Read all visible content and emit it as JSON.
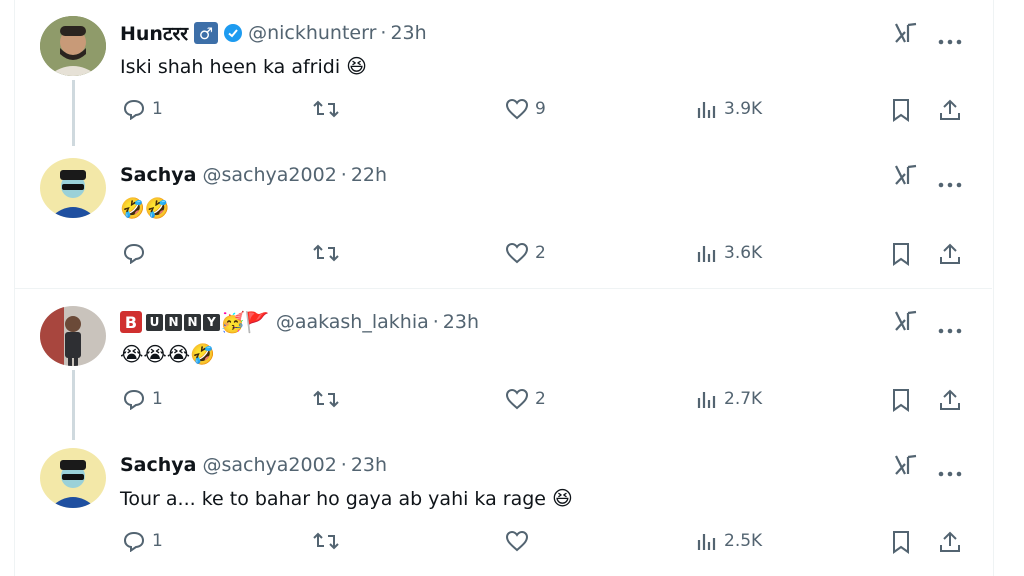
{
  "tweets": [
    {
      "name": "Hunटरर",
      "name_emoji": "♂",
      "verified": true,
      "handle": "@nickhunterr",
      "time": "23h",
      "text": "Iski shah heen ka afridi",
      "text_emoji": "😆",
      "replies": "1",
      "likes": "9",
      "views": "3.9K"
    },
    {
      "name": "Sachya",
      "handle": "@sachya2002",
      "time": "22h",
      "text_emoji": "🤣🤣",
      "replies": "",
      "likes": "2",
      "views": "3.6K"
    },
    {
      "name_letters": [
        "B",
        "U",
        "N",
        "N",
        "Y"
      ],
      "name_emoji": "🥳🚩",
      "handle": "@aakash_lakhia",
      "time": "23h",
      "text_emoji": "😭😭😭🤣",
      "replies": "1",
      "likes": "2",
      "views": "2.7K"
    },
    {
      "name": "Sachya",
      "handle": "@sachya2002",
      "time": "23h",
      "text": "Tour a... ke to bahar ho gaya ab yahi ka rage",
      "text_emoji": "😆",
      "replies": "1",
      "likes": "",
      "views": "2.5K"
    }
  ],
  "icons": {
    "reply": "reply-icon",
    "retweet": "retweet-icon",
    "like": "heart-icon",
    "views": "views-icon",
    "bookmark": "bookmark-icon",
    "share": "share-icon",
    "grok": "grok-icon",
    "more": "more-icon"
  },
  "colors": {
    "verified": "#1d9bf0",
    "muted": "#536471",
    "text": "#0f1419"
  }
}
